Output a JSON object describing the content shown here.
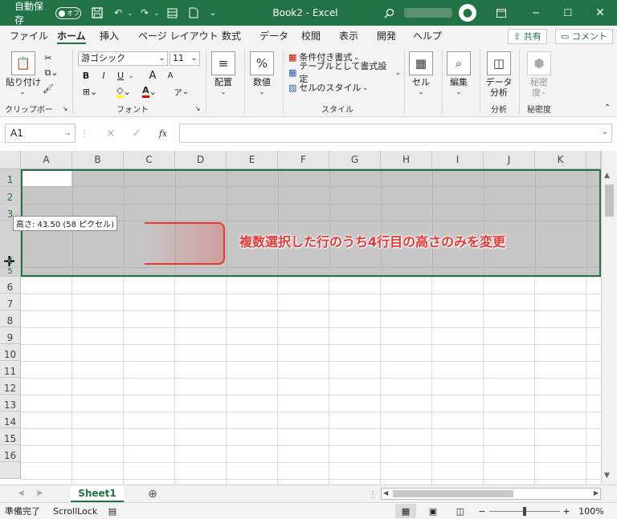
{
  "titlebar": {
    "autosave_label": "自動保存",
    "autosave_state": "オフ",
    "doc_title": "Book2 - Excel",
    "icons": [
      "save-icon",
      "undo-icon",
      "redo-icon",
      "form-icon",
      "pdf-icon",
      "search-icon",
      "ribbon-display-icon",
      "minimize-icon",
      "maximize-icon",
      "close-icon"
    ]
  },
  "menu": {
    "tabs": [
      "ファイル",
      "ホーム",
      "挿入",
      "ページ レイアウト",
      "数式",
      "データ",
      "校閲",
      "表示",
      "開発",
      "ヘルプ"
    ],
    "active_tab": "ホーム",
    "share_label": "共有",
    "comment_label": "コメント"
  },
  "ribbon": {
    "clipboard": {
      "paste_label": "貼り付け",
      "group_label": "クリップボード"
    },
    "font": {
      "font_name": "游ゴシック",
      "font_size": "11",
      "bold": "B",
      "italic": "I",
      "underline": "U",
      "grow": "A",
      "shrink": "A",
      "font_color": "A",
      "phonetic": "ア",
      "group_label": "フォント"
    },
    "alignment": {
      "label": "配置"
    },
    "number": {
      "label": "数値",
      "symbol": "%"
    },
    "styles": {
      "conditional": "条件付き書式",
      "table": "テーブルとして書式設定",
      "cellstyle": "セルのスタイル",
      "group_label": "スタイル"
    },
    "cells": {
      "label": "セル"
    },
    "editing": {
      "label": "編集"
    },
    "analysis": {
      "label_line1": "データ",
      "label_line2": "分析",
      "group_label": "分析"
    },
    "sensitivity": {
      "label_line1": "秘密",
      "label_line2": "度",
      "group_label": "秘密度"
    }
  },
  "formula_bar": {
    "name_box": "A1",
    "fx": "fx",
    "cancel": "×",
    "confirm": "✓",
    "value": ""
  },
  "grid": {
    "columns": [
      "A",
      "B",
      "C",
      "D",
      "E",
      "F",
      "G",
      "H",
      "I",
      "J",
      "K"
    ],
    "rows": [
      "1",
      "2",
      "3",
      "4",
      "5",
      "6",
      "7",
      "8",
      "9",
      "10",
      "11",
      "12",
      "13",
      "14",
      "15",
      "16"
    ],
    "selected_rows": [
      "1",
      "2",
      "3",
      "4",
      "5"
    ],
    "tooltip": "高さ: 43.50 (58 ピクセル)",
    "annotation": "複数選択した行のうち4行目の高さのみを変更"
  },
  "sheets": {
    "tabs": [
      "Sheet1"
    ],
    "active": "Sheet1",
    "add": "⊕"
  },
  "status": {
    "ready": "準備完了",
    "scroll_lock": "ScrollLock",
    "zoom": "100%",
    "minus": "−",
    "plus": "+"
  },
  "colors": {
    "accent": "#217346",
    "selection": "#c6c6c6",
    "annotation": "#e53935"
  }
}
